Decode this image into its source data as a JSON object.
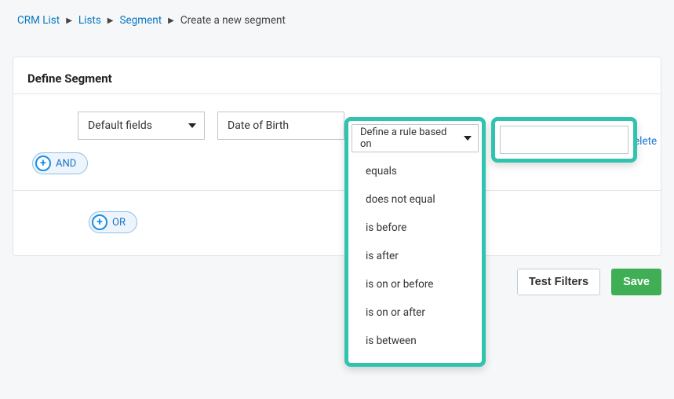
{
  "breadcrumb": {
    "items": [
      "CRM List",
      "Lists",
      "Segment"
    ],
    "current": "Create a new segment"
  },
  "card": {
    "title": "Define Segment"
  },
  "rule": {
    "fieldGroup": "Default fields",
    "field": "Date of Birth",
    "operatorPlaceholder": "Define a rule based on",
    "operators": [
      "equals",
      "does not equal",
      "is before",
      "is after",
      "is on or before",
      "is on or after",
      "is between"
    ],
    "value": "",
    "deleteLabel": "elete"
  },
  "connectors": {
    "and": "AND",
    "or": "OR"
  },
  "actions": {
    "test": "Test Filters",
    "save": "Save"
  }
}
